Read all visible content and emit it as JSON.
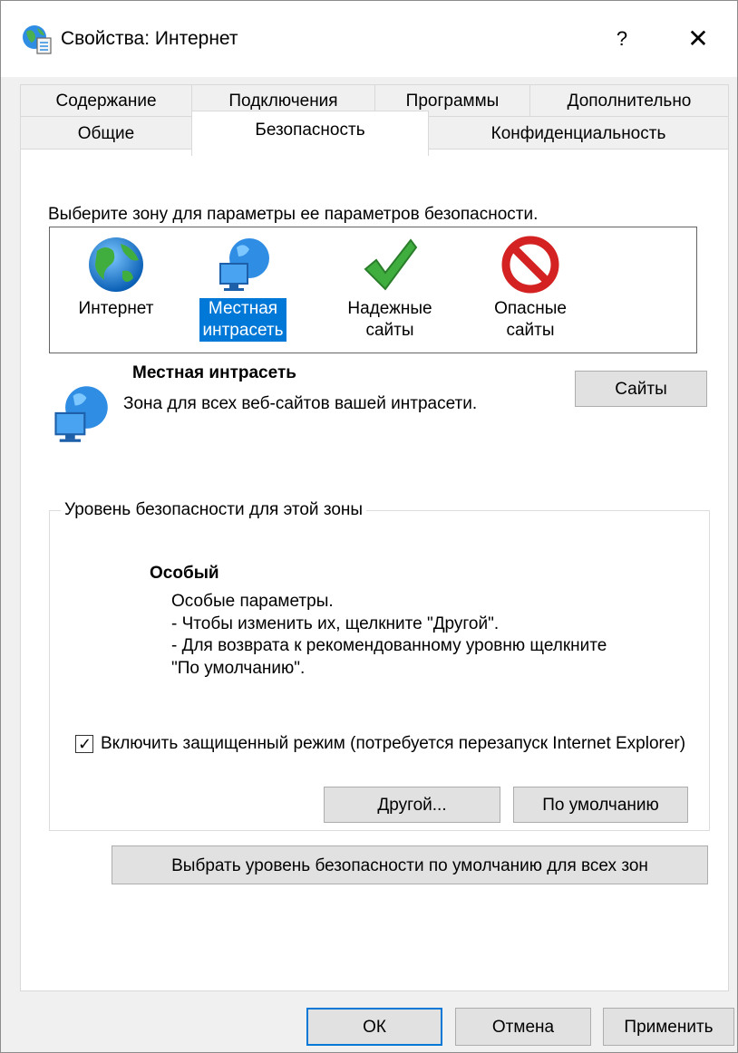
{
  "window": {
    "title": "Свойства: Интернет",
    "help_label": "?",
    "close_label": "✕"
  },
  "tabs": {
    "row1": [
      "Содержание",
      "Подключения",
      "Программы",
      "Дополнительно"
    ],
    "row2": [
      "Общие",
      "Безопасность",
      "Конфиденциальность"
    ],
    "active": "Безопасность"
  },
  "security": {
    "zone_prompt": "Выберите зону для параметры ее параметров безопасности.",
    "zones": [
      {
        "line1": "Интернет",
        "line2": "",
        "icon": "globe-icon",
        "selected": false
      },
      {
        "line1": "Местная",
        "line2": "интрасеть",
        "icon": "intranet-icon",
        "selected": true
      },
      {
        "line1": "Надежные",
        "line2": "сайты",
        "icon": "checkmark-icon",
        "selected": false
      },
      {
        "line1": "Опасные",
        "line2": "сайты",
        "icon": "prohibited-icon",
        "selected": false
      }
    ],
    "selected_zone_title": "Местная интрасеть",
    "selected_zone_desc": "Зона для всех веб-сайтов вашей интрасети.",
    "sites_button": "Сайты",
    "level_group_label": "Уровень безопасности для этой зоны",
    "level_title": "Особый",
    "level_desc": "Особые параметры.\n- Чтобы изменить их, щелкните \"Другой\".\n- Для возврата к рекомендованному уровню щелкните\n\"По умолчанию\".",
    "protected_mode_label": "Включить защищенный режим (потребуется перезапуск Internet Explorer)",
    "protected_mode_checked": true,
    "other_button": "Другой...",
    "default_button": "По умолчанию",
    "all_zones_button": "Выбрать уровень безопасности по умолчанию для всех зон"
  },
  "footer": {
    "ok": "ОК",
    "cancel": "Отмена",
    "apply": "Применить"
  },
  "colors": {
    "selection": "#0078d7",
    "dialog_bg": "#f0f0f0",
    "panel_bg": "#ffffff",
    "button_bg": "#e1e1e1"
  }
}
